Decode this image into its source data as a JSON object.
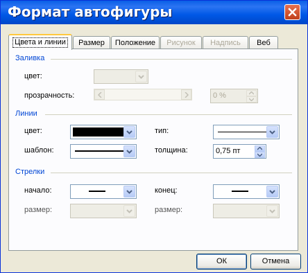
{
  "window": {
    "title": "Формат автофигуры"
  },
  "tabs": [
    {
      "label": "Цвета и линии",
      "state": "active"
    },
    {
      "label": "Размер",
      "state": "normal"
    },
    {
      "label": "Положение",
      "state": "normal"
    },
    {
      "label": "Рисунок",
      "state": "disabled"
    },
    {
      "label": "Надпись",
      "state": "disabled"
    },
    {
      "label": "Веб",
      "state": "normal"
    }
  ],
  "fill": {
    "section_label": "Заливка",
    "color_label": "цвет:",
    "transparency_label": "прозрачность:",
    "transparency_value": "0 %"
  },
  "lines": {
    "section_label": "Линии",
    "color_label": "цвет:",
    "color_value": "#000000",
    "type_label": "тип:",
    "pattern_label": "шаблон:",
    "weight_label": "толщина:",
    "weight_value": "0,75 пт"
  },
  "arrows": {
    "section_label": "Стрелки",
    "begin_label": "начало:",
    "begin_size_label": "размер:",
    "end_label": "конец:",
    "end_size_label": "размер:"
  },
  "buttons": {
    "ok": "ОК",
    "cancel": "Отмена"
  },
  "colors": {
    "titlebar": "#0058e6",
    "section_label": "#0046d5",
    "active_tab_accent": "#ffc83c"
  }
}
